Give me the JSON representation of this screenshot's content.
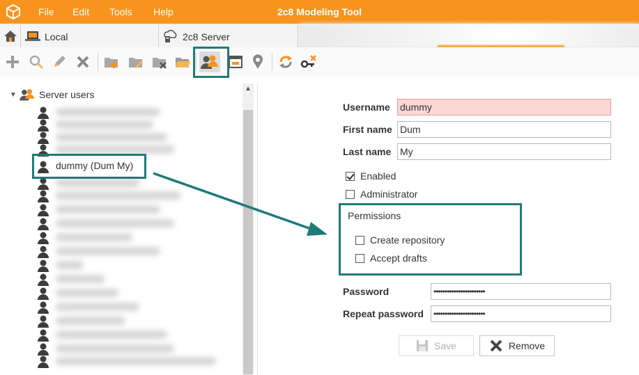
{
  "app": {
    "title": "2c8 Modeling Tool",
    "menu": [
      "File",
      "Edit",
      "Tools",
      "Help"
    ],
    "accent_color": "#f7941d",
    "highlight_color": "#1f7a78"
  },
  "tabs": [
    {
      "label": "Local",
      "icon": "home-icon"
    },
    {
      "label": "2c8 Server",
      "icon": "cloud-server-icon"
    }
  ],
  "toolbar": {
    "items": [
      "add-icon",
      "search-icon",
      "edit-icon",
      "delete-icon",
      "new-folder-icon",
      "edit-folder-icon",
      "delete-folder-icon",
      "open-folder-icon",
      "server-users-icon",
      "window-icon",
      "location-pin-icon",
      "sync-icon",
      "key-remove-icon"
    ],
    "active": "server-users-icon"
  },
  "tree": {
    "root_label": "Server users",
    "selected_user": "dummy (Dum My)"
  },
  "form": {
    "username_label": "Username",
    "username_value": "dummy",
    "first_name_label": "First name",
    "first_name_value": "Dum",
    "last_name_label": "Last name",
    "last_name_value": "My",
    "enabled_label": "Enabled",
    "enabled_checked": true,
    "administrator_label": "Administrator",
    "administrator_checked": false,
    "permissions_title": "Permissions",
    "create_repository_label": "Create repository",
    "create_repository_checked": false,
    "accept_drafts_label": "Accept drafts",
    "accept_drafts_checked": false,
    "password_label": "Password",
    "password_value": "•••••••••••••••••••••••",
    "repeat_password_label": "Repeat password",
    "repeat_password_value": "•••••••••••••••••••••••",
    "save_label": "Save",
    "remove_label": "Remove"
  }
}
